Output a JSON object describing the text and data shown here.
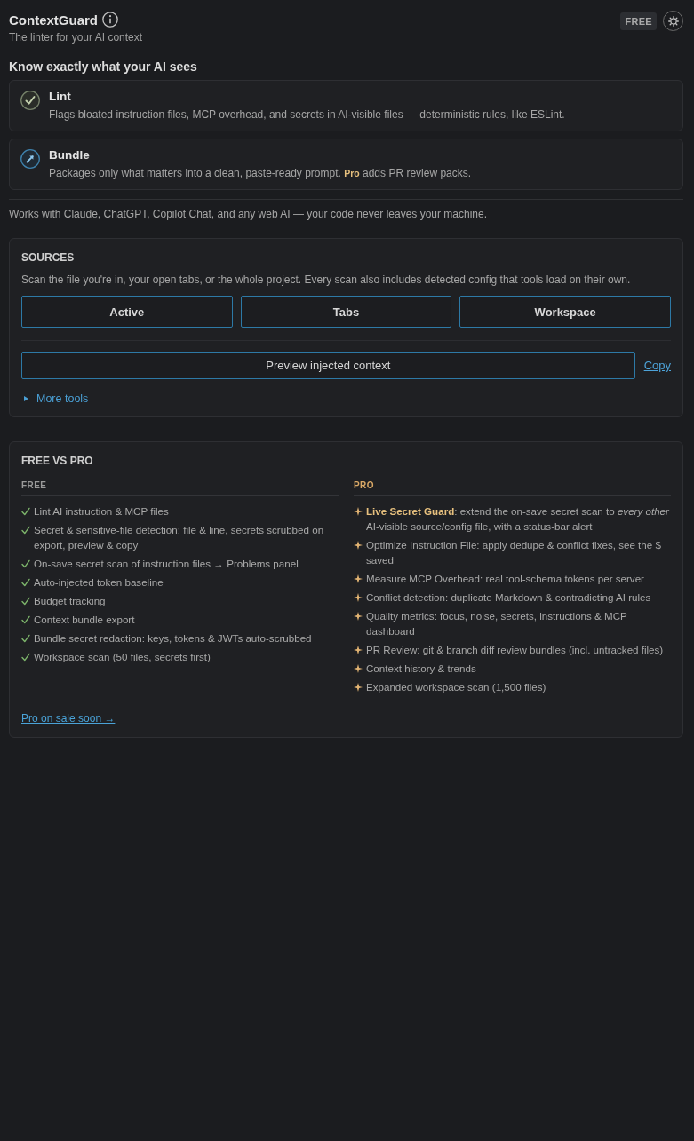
{
  "header": {
    "title": "ContextGuard",
    "subtitle": "The linter for your AI context",
    "plan_badge": "FREE"
  },
  "intro": {
    "heading": "Know exactly what your AI sees",
    "features": [
      {
        "kind": "lint",
        "title": "Lint",
        "description": "Flags bloated instruction files, MCP overhead, and secrets in AI-visible files — deterministic rules, like ESLint."
      },
      {
        "kind": "bundle",
        "title": "Bundle",
        "description": "Packages only what matters into a clean, paste-ready prompt. **Pro** adds PR review packs."
      }
    ],
    "note": "Works with Claude, ChatGPT, Copilot Chat, and any web AI — your code never leaves your machine."
  },
  "sources": {
    "title": "SOURCES",
    "description": "Scan the file you're in, your open tabs, or the whole project. Every scan also includes detected config that tools load on their own.",
    "scopes": [
      "Active",
      "Tabs",
      "Workspace"
    ],
    "preview_button": "Preview injected context",
    "copy_link": "Copy",
    "more_tools": {
      "label": "More tools",
      "expanded": false
    }
  },
  "plans": {
    "title": "FREE VS PRO",
    "columns": [
      {
        "kind": "free",
        "heading": "FREE",
        "items": [
          "Lint AI instruction & MCP files",
          "Secret & sensitive-file detection: file & line, secrets scrubbed on export, preview & copy",
          "On-save secret scan of instruction files → Problems panel",
          "Auto-injected token baseline",
          "Budget tracking",
          "Context bundle export",
          "Bundle secret redaction: keys, tokens & JWTs auto-scrubbed",
          "Workspace scan (50 files, secrets first)"
        ]
      },
      {
        "kind": "pro",
        "heading": "PRO",
        "items": [
          "**Live Secret Guard**: extend the on-save secret scan to *every other* AI-visible source/config file, with a status-bar alert",
          "Optimize Instruction File: apply dedupe & conflict fixes, see the $ saved",
          "Measure MCP Overhead: real tool-schema tokens per server",
          "Conflict detection: duplicate Markdown & contradicting AI rules",
          "Quality metrics: focus, noise, secrets, instructions & MCP dashboard",
          "PR Review: git & branch diff review bundles (incl. untracked files)",
          "Context history & trends",
          "Expanded workspace scan (1,500 files)"
        ]
      }
    ],
    "link": "Pro on sale soon →"
  }
}
